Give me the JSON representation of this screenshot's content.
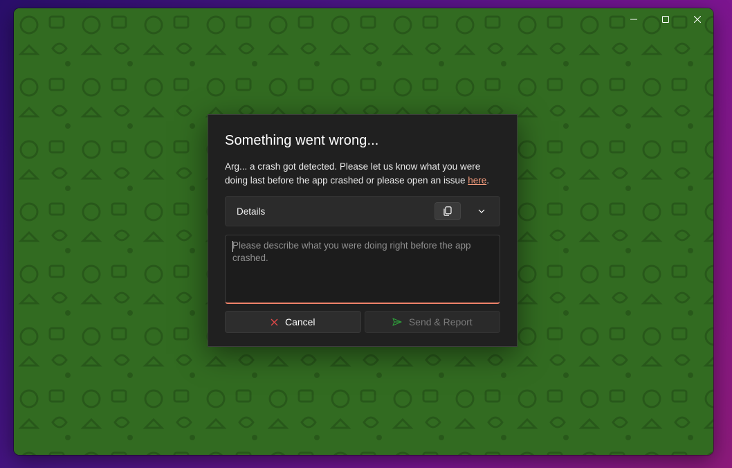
{
  "window": {
    "caption": {
      "minimize_icon": "minimize-icon",
      "maximize_icon": "maximize-icon",
      "close_icon": "close-icon"
    },
    "background_color": "#3a7a26"
  },
  "dialog": {
    "title": "Something went wrong...",
    "message_text": "Arg... a crash got detected. Please let us know what you were doing last before the app crashed or please open an issue ",
    "message_link": "here",
    "message_end": ".",
    "details": {
      "label": "Details",
      "copy_icon": "copy-icon",
      "expand_icon": "chevron-down-icon"
    },
    "description_input": {
      "value": "",
      "placeholder": "Please describe what you were doing right before the app crashed."
    },
    "cancel_button": {
      "label": "Cancel",
      "icon": "close-icon",
      "icon_color": "#e04848"
    },
    "send_button": {
      "label": "Send & Report",
      "icon": "send-icon",
      "icon_color": "#2f9a3a",
      "enabled": false
    },
    "accent_color": "#f0836a"
  }
}
